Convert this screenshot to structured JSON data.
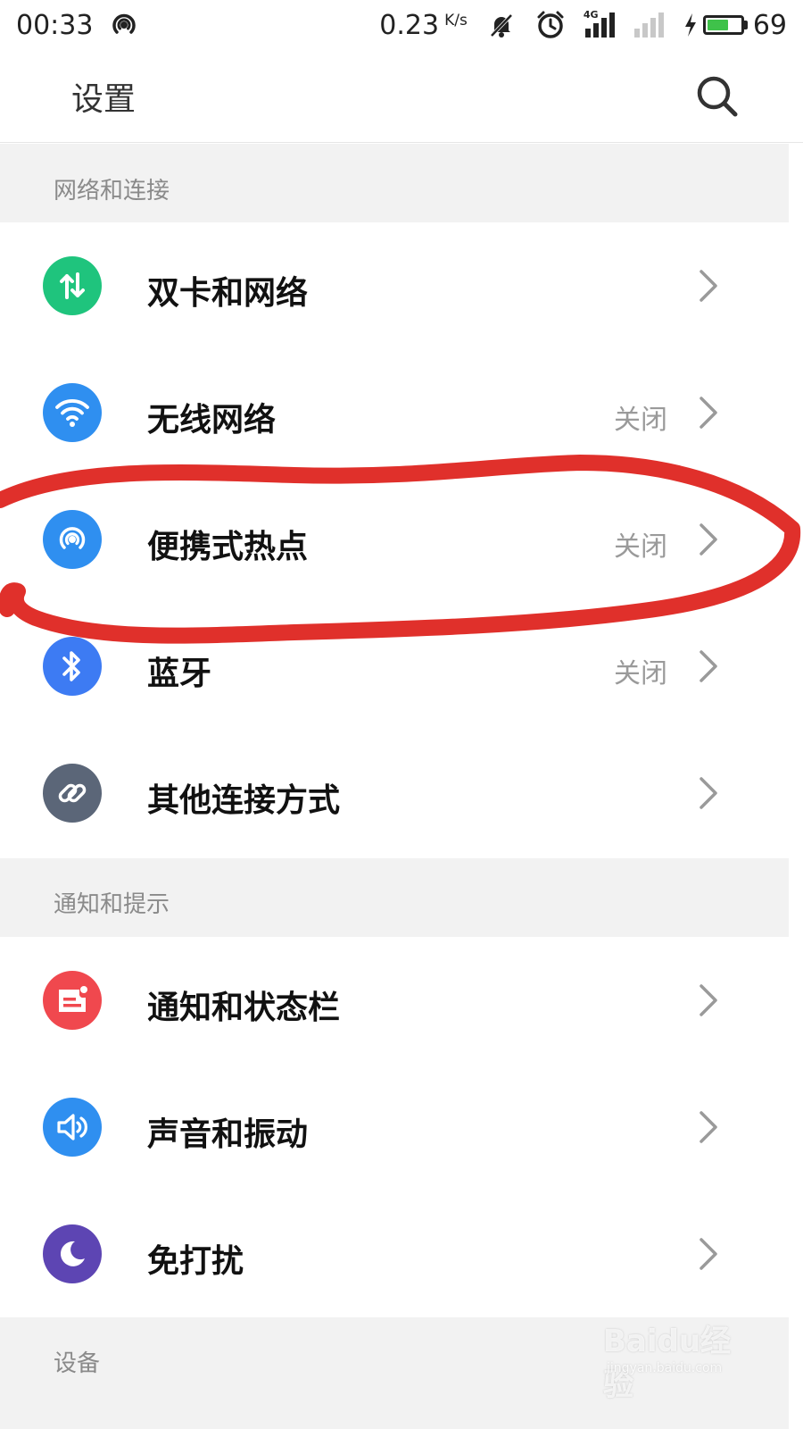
{
  "status_bar": {
    "time": "00:33",
    "speed_value": "0.23",
    "speed_unit": "K/s",
    "network_tag": "4G",
    "battery_level": 69,
    "battery_text": "69",
    "icons": [
      "hotspot-icon",
      "bell-off-icon",
      "alarm-icon",
      "signal-icon",
      "signal-off-icon",
      "charging-icon",
      "battery-icon"
    ]
  },
  "header": {
    "title": "设置",
    "search_icon": "search-icon"
  },
  "sections": [
    {
      "title": "网络和连接",
      "items": [
        {
          "label": "双卡和网络",
          "value": "",
          "icon": "data-arrows-icon",
          "color": "#1fc47d"
        },
        {
          "label": "无线网络",
          "value": "关闭",
          "icon": "wifi-icon",
          "color": "#2f8ff0"
        },
        {
          "label": "便携式热点",
          "value": "关闭",
          "icon": "hotspot-icon",
          "color": "#2f8ff0"
        },
        {
          "label": "蓝牙",
          "value": "关闭",
          "icon": "bluetooth-icon",
          "color": "#3d7bf3"
        },
        {
          "label": "其他连接方式",
          "value": "",
          "icon": "link-icon",
          "color": "#5b6678"
        }
      ]
    },
    {
      "title": "通知和提示",
      "items": [
        {
          "label": "通知和状态栏",
          "value": "",
          "icon": "notification-icon",
          "color": "#f0484e"
        },
        {
          "label": "声音和振动",
          "value": "",
          "icon": "speaker-icon",
          "color": "#2f8ff0"
        },
        {
          "label": "免打扰",
          "value": "",
          "icon": "moon-icon",
          "color": "#5d45b3"
        }
      ]
    },
    {
      "title": "设备",
      "items": []
    }
  ],
  "annotation_color": "#e0302b",
  "watermark": {
    "text": "Baidu经验",
    "sub": "jingyan.baidu.com"
  }
}
